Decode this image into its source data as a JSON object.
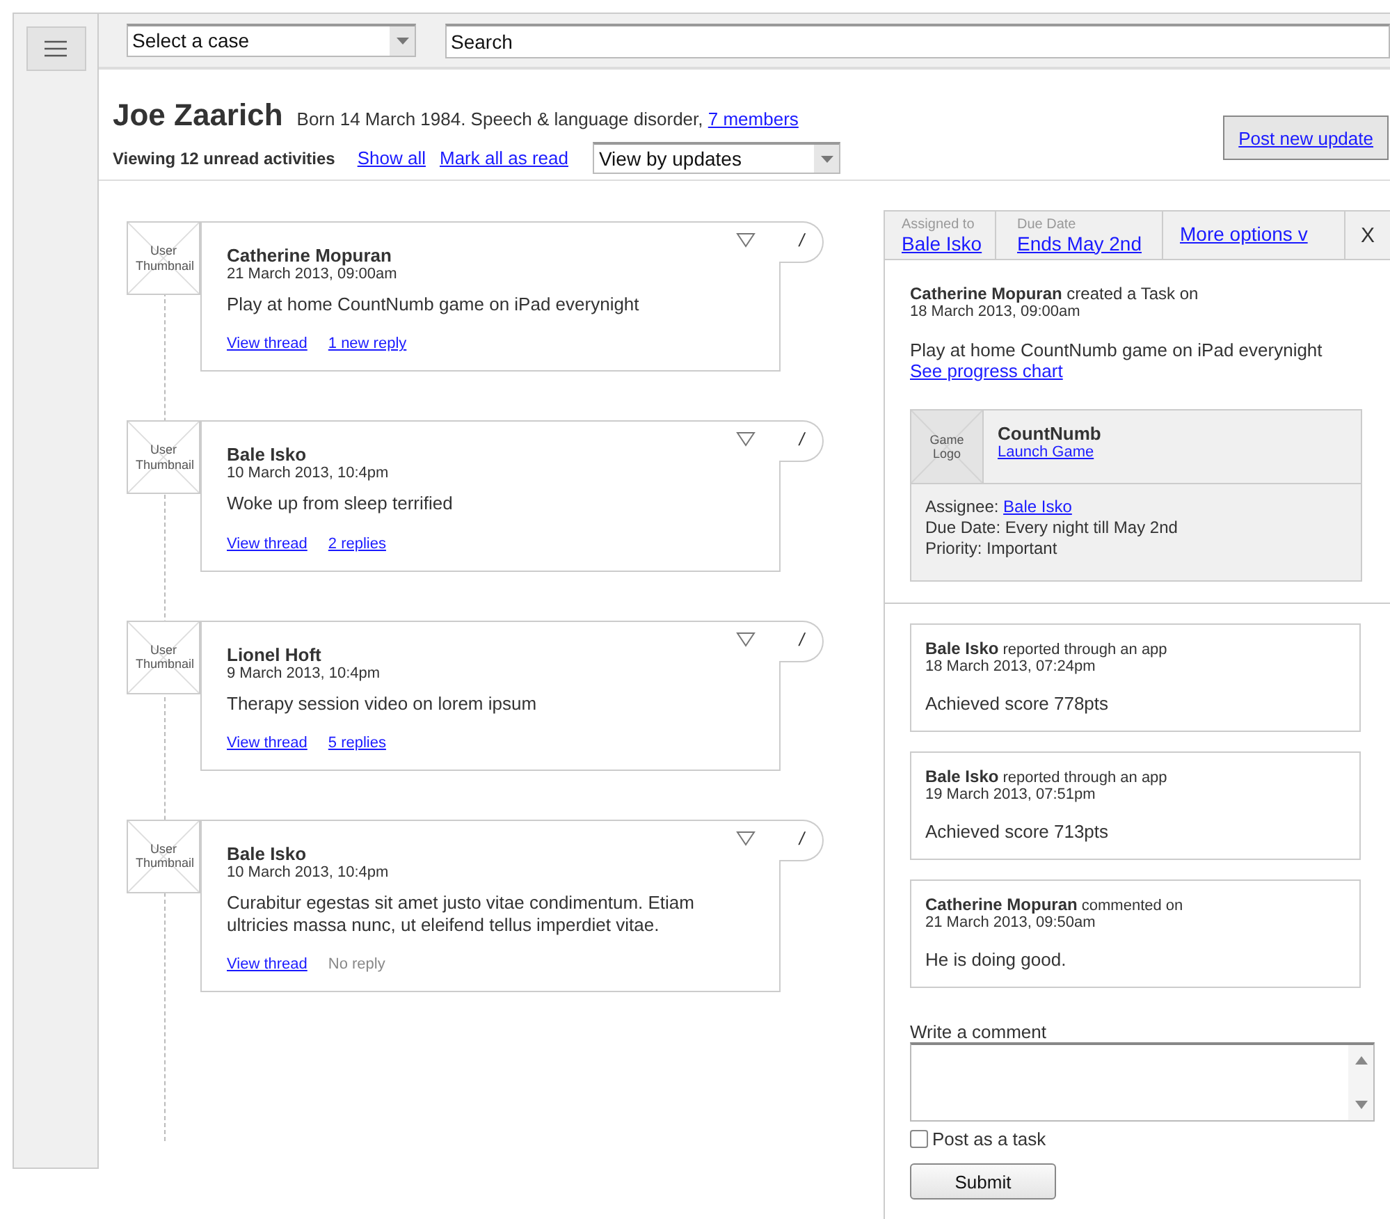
{
  "topbar": {
    "case_select": {
      "value": "Select a case"
    },
    "search": {
      "value": "Search"
    }
  },
  "header": {
    "name": "Joe Zaarich",
    "info": "Born 14 March 1984. Speech & language disorder,",
    "members_link": "7 members",
    "viewing": "Viewing 12 unread activities",
    "show_all": "Show all",
    "mark_read": "Mark all as read",
    "view_select": {
      "value": "View by updates"
    },
    "post_button": "Post new update"
  },
  "feed": [
    {
      "thumbnail": "User Thumbnail",
      "author": "Catherine Mopuran",
      "date": "21 March 2013, 09:00am",
      "body": "Play at home CountNumb game on iPad everynight",
      "thread_link": "View thread",
      "replies": {
        "text": "1 new reply",
        "kind": "link"
      },
      "action_glyph": "/"
    },
    {
      "thumbnail": "User Thumbnail",
      "author": "Bale Isko",
      "date": "10 March 2013, 10:4pm",
      "body": "Woke up from sleep terrified",
      "thread_link": "View thread",
      "replies": {
        "text": "2 replies",
        "kind": "link"
      },
      "action_glyph": "/"
    },
    {
      "thumbnail": "User Thumbnail",
      "author": "Lionel Hoft",
      "date": "9 March 2013, 10:4pm",
      "body": "Therapy session video on lorem ipsum",
      "thread_link": "View thread",
      "replies": {
        "text": "5 replies",
        "kind": "link"
      },
      "action_glyph": "/"
    },
    {
      "thumbnail": "User Thumbnail",
      "author": "Bale Isko",
      "date": "10 March 2013, 10:4pm",
      "body": "Curabitur egestas sit amet justo vitae condimentum. Etiam ultricies massa nunc, ut eleifend tellus imperdiet vitae.",
      "thread_link": "View thread",
      "replies": {
        "text": "No reply",
        "kind": "none"
      },
      "action_glyph": "/"
    }
  ],
  "detail": {
    "tabs": [
      {
        "label": "Assigned to",
        "value": "Bale Isko"
      },
      {
        "label": "Due Date",
        "value": "Ends May 2nd"
      }
    ],
    "more_options": "More options v",
    "close": "X",
    "task": {
      "header": "**Catherine Mopuran** created a Task on",
      "date": "18 March 2013, 09:00am",
      "body": "Play at home CountNumb game on iPad everynight",
      "chart_link": "See progress chart",
      "game": {
        "logo": "Game Logo",
        "name": "CountNumb",
        "launch": "Launch Game",
        "assignee_label": "Assignee:",
        "assignee": "Bale Isko",
        "due": "Due Date: Every night till May 2nd",
        "priority": "Priority: Important"
      }
    },
    "updates": [
      {
        "author": "Bale Isko",
        "action": "reported through an app",
        "date": "18 March 2013, 07:24pm",
        "body": "Achieved score 778pts"
      },
      {
        "author": "Bale Isko",
        "action": "reported through an app",
        "date": "19 March 2013, 07:51pm",
        "body": "Achieved score 713pts"
      },
      {
        "author": "Catherine Mopuran",
        "action": "commented on",
        "date": "21 March 2013, 09:50am",
        "body": "He is doing good."
      }
    ],
    "comment": {
      "label": "Write a comment",
      "post_as_task": {
        "label": "Post as a task",
        "checked": false
      },
      "submit": "Submit"
    }
  }
}
